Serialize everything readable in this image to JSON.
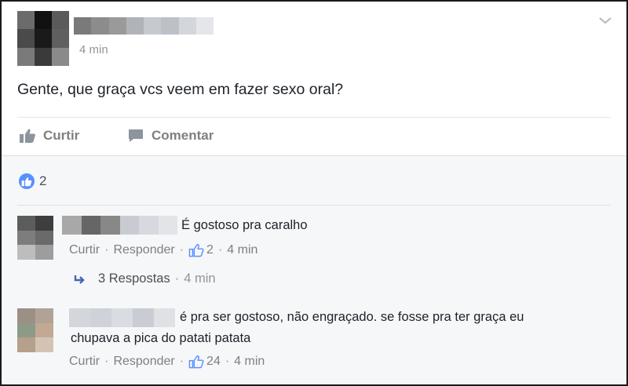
{
  "post": {
    "time": "4 min",
    "text": "Gente, que graça vcs veem em fazer sexo oral?",
    "actions": {
      "like_label": "Curtir",
      "comment_label": "Comentar"
    },
    "reaction_count": "2"
  },
  "comments": [
    {
      "text": "É gostoso pra caralho",
      "like_label": "Curtir",
      "reply_label": "Responder",
      "likes": "2",
      "time": "4 min",
      "replies": {
        "label": "3 Respostas",
        "time": "4 min"
      }
    },
    {
      "text_line1": "é pra ser gostoso, não engraçado. se fosse pra ter graça eu",
      "text_line2": "chupava a pica do patati patata",
      "like_label": "Curtir",
      "reply_label": "Responder",
      "likes": "24",
      "time": "4 min"
    }
  ],
  "colors": {
    "accent": "#5890ff",
    "muted_text": "#7f7f7f",
    "comments_bg": "#f6f7f9"
  },
  "icons": {
    "like": "thumbs-up-icon",
    "comment": "speech-bubble-icon",
    "reply_arrow": "reply-arrow-icon",
    "menu": "chevron-down-icon"
  }
}
